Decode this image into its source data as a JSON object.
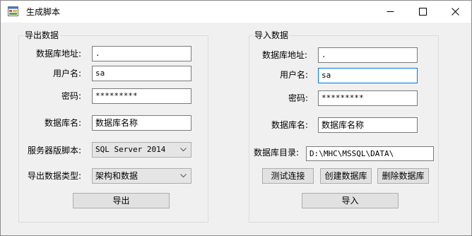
{
  "window": {
    "title": "生成脚本",
    "icon": "app-form-icon",
    "controls": [
      "minimize-icon",
      "maximize-icon",
      "close-icon"
    ]
  },
  "export": {
    "legend": "导出数据",
    "server_label": "数据库地址:",
    "server_value": ".",
    "user_label": "用户名:",
    "user_value": "sa",
    "password_label": "密码:",
    "password_value": "*********",
    "dbname_label": "数据库名:",
    "dbname_value": "数据库名称",
    "version_label": "服务器版脚本:",
    "version_value": "SQL Server 2014",
    "type_label": "导出数据类型:",
    "type_value": "架构和数据",
    "export_button": "导出"
  },
  "import": {
    "legend": "导入数据",
    "server_label": "数据库地址:",
    "server_value": ".",
    "user_label": "用户名:",
    "user_value": "sa",
    "password_label": "密码:",
    "password_value": "*********",
    "dbname_label": "数据库名:",
    "dbname_value": "数据库名称",
    "dir_label": "数据库目录:",
    "dir_value": "D:\\MHC\\MSSQL\\DATA\\",
    "test_button": "测试连接",
    "create_button": "创建数据库",
    "delete_button": "删除数据库",
    "import_button": "导入"
  },
  "colors": {
    "window_bg": "#f0f0f0",
    "titlebar_bg": "#ffffff",
    "focus_border": "#0078d7",
    "button_bg": "#e1e1e1"
  }
}
